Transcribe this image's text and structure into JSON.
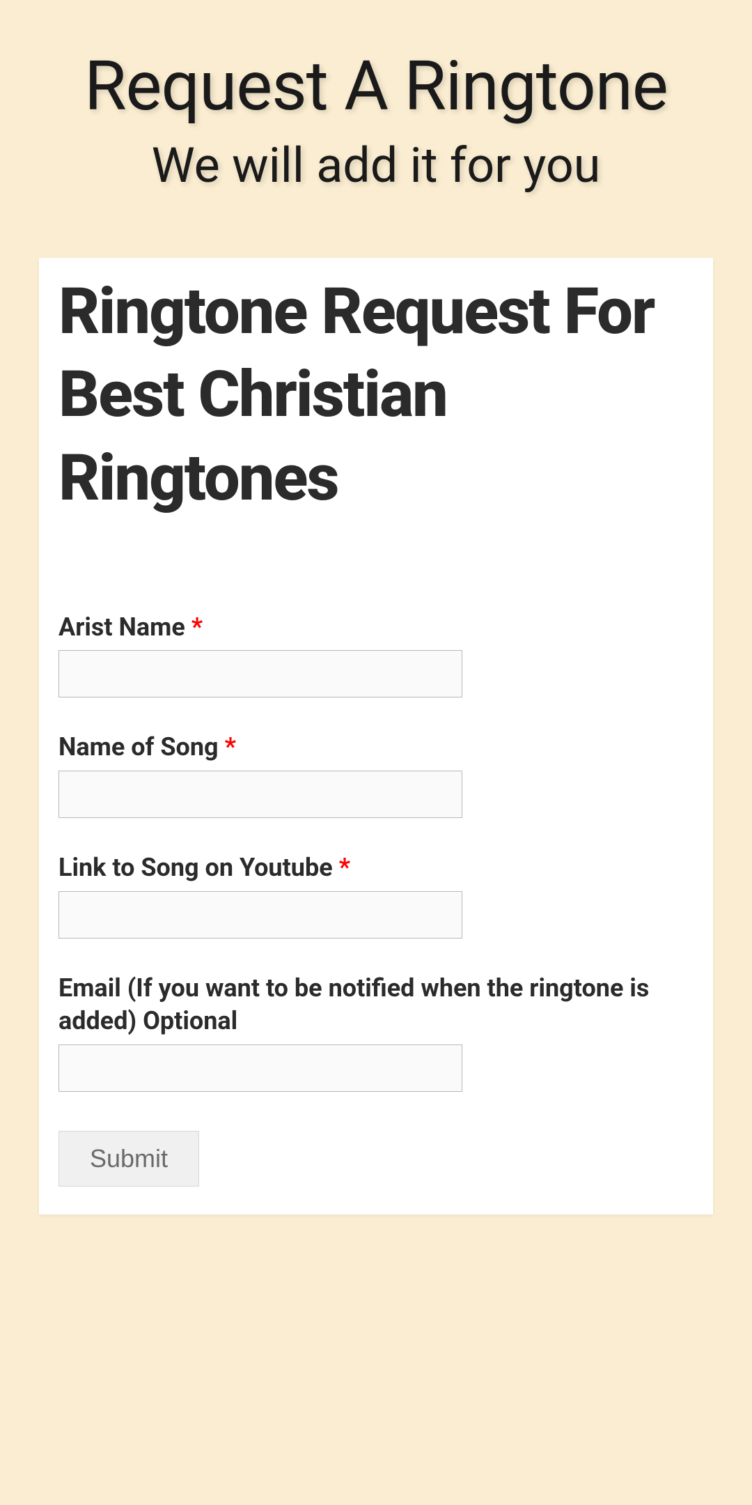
{
  "header": {
    "title": "Request A Ringtone",
    "subtitle": "We will add it for you"
  },
  "form": {
    "title": "Ringtone Request For Best Christian Ringtones",
    "required_marker": "*",
    "fields": {
      "artist": {
        "label": "Arist Name ",
        "required": true,
        "value": ""
      },
      "song": {
        "label": "Name of Song ",
        "required": true,
        "value": ""
      },
      "youtube": {
        "label": "Link to Song on Youtube ",
        "required": true,
        "value": ""
      },
      "email": {
        "label": "Email (If you want to be notified when the ringtone is added) Optional",
        "required": false,
        "value": ""
      }
    },
    "submit_label": "Submit"
  }
}
